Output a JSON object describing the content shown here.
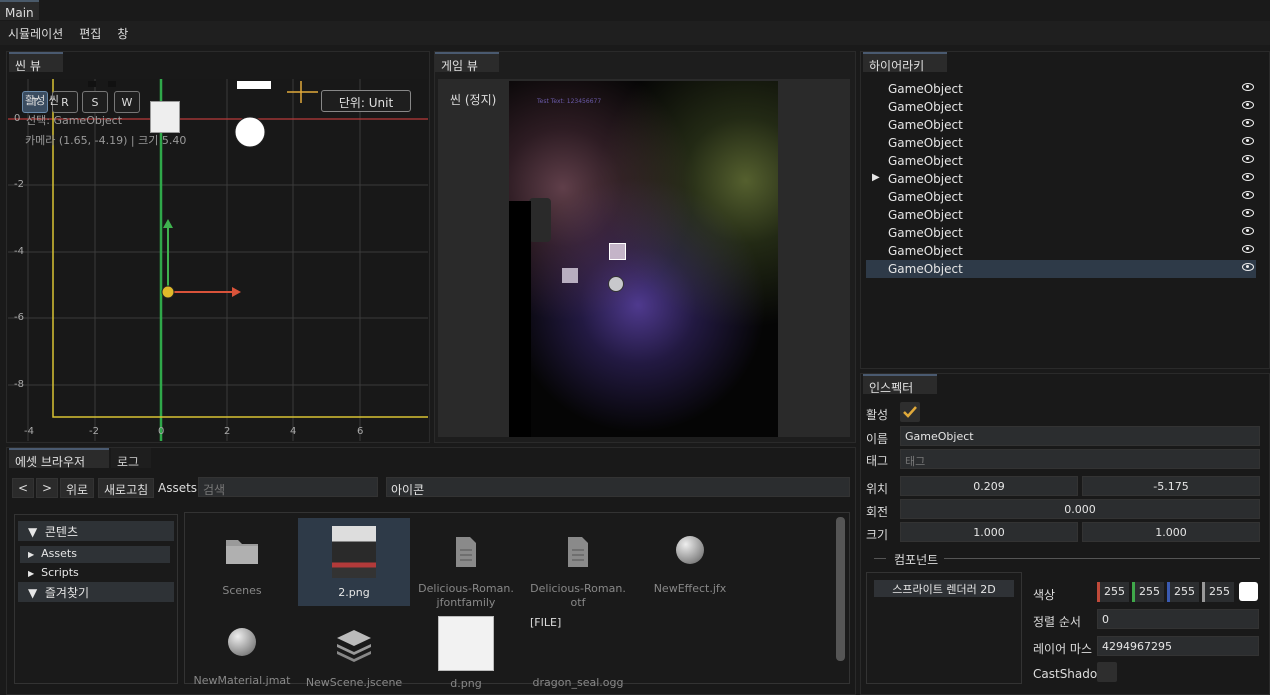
{
  "window": {
    "tab": "Main"
  },
  "menu": [
    "시뮬레이션",
    "편집",
    "창"
  ],
  "scene_view": {
    "tab": "씬 뷰",
    "tools": [
      "T",
      "R",
      "S",
      "W"
    ],
    "overlay_active": "활성 씬",
    "overlay_selected": "선택: GameObject",
    "overlay_camera": "카메라 (1.65, -4.19) | 크기 5.40",
    "unit_button": "단위: Unit",
    "x_ticks": [
      "-4",
      "-2",
      "0",
      "2",
      "4",
      "6"
    ],
    "y_ticks": [
      "0",
      "-2",
      "-4",
      "-6",
      "-8"
    ]
  },
  "game_view": {
    "tab": "게임 뷰",
    "status": "씬 (정지)",
    "test_text": "Test Text: 123456677"
  },
  "hierarchy": {
    "tab": "하이어라키",
    "items": [
      {
        "label": "GameObject",
        "expander": ""
      },
      {
        "label": "GameObject",
        "expander": ""
      },
      {
        "label": "GameObject",
        "expander": ""
      },
      {
        "label": "GameObject",
        "expander": ""
      },
      {
        "label": "GameObject",
        "expander": ""
      },
      {
        "label": "GameObject",
        "expander": "▶"
      },
      {
        "label": "GameObject",
        "expander": ""
      },
      {
        "label": "GameObject",
        "expander": ""
      },
      {
        "label": "GameObject",
        "expander": ""
      },
      {
        "label": "GameObject",
        "expander": ""
      },
      {
        "label": "GameObject",
        "expander": ""
      }
    ],
    "selected_index": 10
  },
  "inspector": {
    "tab": "인스펙터",
    "active_label": "활성",
    "name_label": "이름",
    "name_value": "GameObject",
    "tag_label": "태그",
    "tag_placeholder": "태그",
    "position_label": "위치",
    "position_x": "0.209",
    "position_y": "-5.175",
    "rotation_label": "회전",
    "rotation_value": "0.000",
    "scale_label": "크기",
    "scale_x": "1.000",
    "scale_y": "1.000",
    "components_label": "컴포넌트",
    "component_name": "스프라이트 렌더러 2D",
    "color_label": "색상",
    "color_r": "255",
    "color_g": "255",
    "color_b": "255",
    "color_a": "255",
    "sort_label": "정렬 순서",
    "sort_value": "0",
    "layer_label": "레이어 마스",
    "layer_value": "4294967295",
    "shadow_label": "CastShado"
  },
  "asset_browser": {
    "tab": "에셋 브라우저",
    "log_tab": "로그",
    "back": "<",
    "forward": ">",
    "up": "위로",
    "refresh": "새로고침",
    "path": "Assets",
    "search_placeholder": "검색",
    "view_mode": "아이콘",
    "tree": {
      "content": "콘텐츠",
      "assets": "Assets",
      "scripts": "Scripts",
      "favorites": "즐겨찾기"
    },
    "items": [
      {
        "name": "Scenes",
        "icon": "folder-icon"
      },
      {
        "name": "2.png",
        "icon": "sprite-thumbnail"
      },
      {
        "name": "Delicious-Roman.\njfontfamily",
        "icon": "file-icon"
      },
      {
        "name": "Delicious-Roman.\notf",
        "icon": "file-icon"
      },
      {
        "name": "NewEffect.jfx",
        "icon": "sphere-icon"
      },
      {
        "name": "NewMaterial.jmat",
        "icon": "sphere-icon"
      },
      {
        "name": "NewScene.jscene",
        "icon": "layers-icon"
      },
      {
        "name": "d.png",
        "icon": "sprite-thumbnail"
      },
      {
        "name": "dragon_seal.ogg",
        "icon": "file-icon"
      }
    ],
    "file_badge": "[FILE]"
  },
  "colors": {
    "accent": "#e0a93a",
    "selection": "#2e3a48",
    "x_axis": "#d9533a",
    "y_axis": "#3fb24e"
  }
}
